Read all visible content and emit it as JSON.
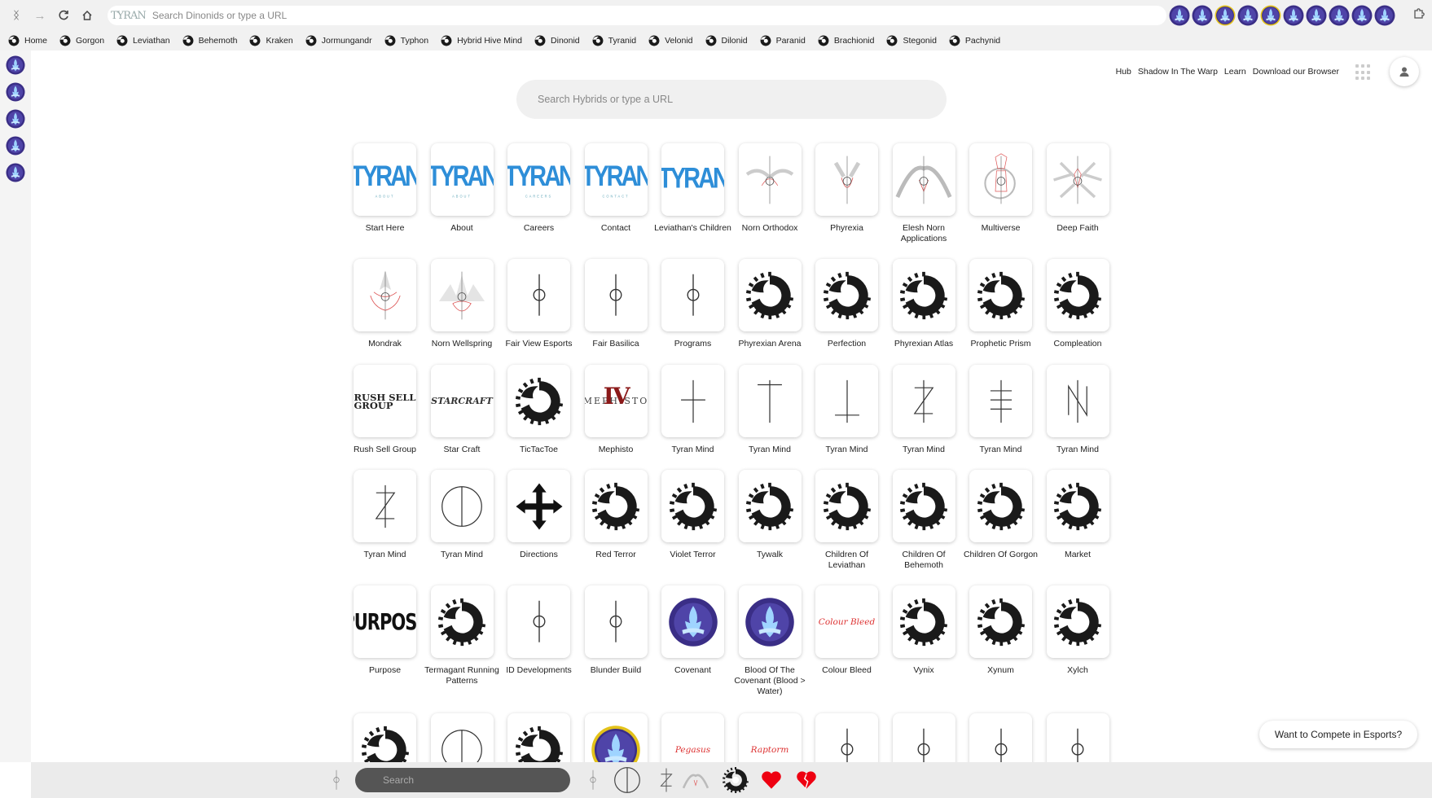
{
  "browser": {
    "url_placeholder": "Search Dinonids or type a URL",
    "logo_text": "TYRAN",
    "extensions_count": 10
  },
  "bookmarks": [
    "Home",
    "Gorgon",
    "Leviathan",
    "Behemoth",
    "Kraken",
    "Jormungandr",
    "Typhon",
    "Hybrid Hive Mind",
    "Dinonid",
    "Tyranid",
    "Velonid",
    "Dilonid",
    "Paranid",
    "Brachionid",
    "Stegonid",
    "Pachynid"
  ],
  "nav": {
    "links": [
      "Hub",
      "Shadow In The Warp",
      "Learn",
      "Download our Browser"
    ]
  },
  "search": {
    "placeholder": "Search Hybrids or type a URL"
  },
  "tiles": [
    {
      "label": "Start Here",
      "icon": "tyran-logo",
      "logo_text": "TYRAN",
      "logo_sub": "ABOUT"
    },
    {
      "label": "About",
      "icon": "tyran-logo",
      "logo_text": "TYRAN",
      "logo_sub": "ABOUT"
    },
    {
      "label": "Careers",
      "icon": "tyran-logo",
      "logo_text": "TYRAN",
      "logo_sub": "CAREERS"
    },
    {
      "label": "Contact",
      "icon": "tyran-logo",
      "logo_text": "TYRAN",
      "logo_sub": "CONTACT"
    },
    {
      "label": "Leviathan's Children",
      "icon": "tyran-logo",
      "logo_text": "TYRAN",
      "logo_sub": ""
    },
    {
      "label": "Norn Orthodox",
      "icon": "norn-orthodox-icon"
    },
    {
      "label": "Phyrexia",
      "icon": "phyrexia-icon"
    },
    {
      "label": "Elesh Norn Applications",
      "icon": "elesh-norn-icon"
    },
    {
      "label": "Multiverse",
      "icon": "multiverse-icon"
    },
    {
      "label": "Deep Faith",
      "icon": "deep-faith-icon"
    },
    {
      "label": "Mondrak",
      "icon": "mondrak-icon"
    },
    {
      "label": "Norn Wellspring",
      "icon": "norn-wellspring-icon"
    },
    {
      "label": "Fair View Esports",
      "icon": "phyrexian-glyph-icon"
    },
    {
      "label": "Fair Basilica",
      "icon": "phyrexian-glyph-icon"
    },
    {
      "label": "Programs",
      "icon": "phyrexian-glyph-icon"
    },
    {
      "label": "Phyrexian Arena",
      "icon": "tyranid-hive-icon"
    },
    {
      "label": "Perfection",
      "icon": "tyranid-hive-icon"
    },
    {
      "label": "Phyrexian Atlas",
      "icon": "tyranid-hive-icon"
    },
    {
      "label": "Prophetic Prism",
      "icon": "tyranid-hive-icon"
    },
    {
      "label": "Compleation",
      "icon": "tyranid-hive-icon"
    },
    {
      "label": "Rush Sell Group",
      "icon": "rush-sell-logo",
      "logo_text": "RUSH SELL GROUP"
    },
    {
      "label": "Star Craft",
      "icon": "starcraft-logo",
      "logo_text": "STARCRAFT"
    },
    {
      "label": "TicTacToe",
      "icon": "tyranid-hive-icon"
    },
    {
      "label": "Mephisto",
      "icon": "mephisto-logo",
      "logo_text": "MEPHISTO",
      "logo_numeral": "IV"
    },
    {
      "label": "Tyran Mind",
      "icon": "rune-cross-icon"
    },
    {
      "label": "Tyran Mind",
      "icon": "rune-t-icon"
    },
    {
      "label": "Tyran Mind",
      "icon": "rune-inverted-t-icon"
    },
    {
      "label": "Tyran Mind",
      "icon": "rune-z-icon"
    },
    {
      "label": "Tyran Mind",
      "icon": "rune-triple-bar-icon"
    },
    {
      "label": "Tyran Mind",
      "icon": "rune-n-icon"
    },
    {
      "label": "Tyran Mind",
      "icon": "rune-z-icon"
    },
    {
      "label": "Tyran Mind",
      "icon": "rune-circle-icon"
    },
    {
      "label": "Directions",
      "icon": "directions-icon"
    },
    {
      "label": "Red Terror",
      "icon": "tyranid-hive-icon"
    },
    {
      "label": "Violet Terror",
      "icon": "tyranid-hive-icon"
    },
    {
      "label": "Tywalk",
      "icon": "tyranid-hive-icon"
    },
    {
      "label": "Children Of Leviathan",
      "icon": "tyranid-hive-icon"
    },
    {
      "label": "Children Of Behemoth",
      "icon": "tyranid-hive-icon"
    },
    {
      "label": "Children Of Gorgon",
      "icon": "tyranid-hive-icon"
    },
    {
      "label": "Market",
      "icon": "tyranid-hive-icon"
    },
    {
      "label": "Purpose",
      "icon": "purpose-logo",
      "logo_text": "PURPOSE"
    },
    {
      "label": "Termagant Running Patterns",
      "icon": "tyranid-hive-icon"
    },
    {
      "label": "ID Developments",
      "icon": "phyrexian-glyph-icon"
    },
    {
      "label": "Blunder Build",
      "icon": "phyrexian-glyph-icon"
    },
    {
      "label": "Covenant",
      "icon": "covenant-emblem-icon"
    },
    {
      "label": "Blood Of The Covenant (Blood > Water)",
      "icon": "covenant-emblem-icon"
    },
    {
      "label": "Colour Bleed",
      "icon": "colour-bleed-logo",
      "logo_text": "Colour Bleed"
    },
    {
      "label": "Vynix",
      "icon": "tyranid-hive-icon"
    },
    {
      "label": "Xynum",
      "icon": "tyranid-hive-icon"
    },
    {
      "label": "Xylch",
      "icon": "tyranid-hive-icon"
    },
    {
      "label": "",
      "icon": "tyranid-hive-icon"
    },
    {
      "label": "",
      "icon": "rune-circle-icon"
    },
    {
      "label": "",
      "icon": "tyranid-hive-icon"
    },
    {
      "label": "",
      "icon": "covenant-gold-emblem-icon"
    },
    {
      "label": "",
      "icon": "pegasus-script-logo",
      "logo_text": "Pegasus"
    },
    {
      "label": "",
      "icon": "raptorm-script-logo",
      "logo_text": "Raptorm"
    },
    {
      "label": "",
      "icon": "phyrexian-glyph-icon"
    },
    {
      "label": "",
      "icon": "phyrexian-glyph-icon"
    },
    {
      "label": "",
      "icon": "phyrexian-glyph-icon"
    },
    {
      "label": "",
      "icon": "phyrexian-glyph-icon"
    }
  ],
  "dock": {
    "search_placeholder": "Search",
    "icons": [
      "phyrexian-glyph-icon",
      "phyrexian-glyph-icon",
      "rune-circle-icon",
      "rune-z-icon",
      "elesh-norn-icon",
      "tyranid-hive-icon",
      "red-heart-icon",
      "broken-heart-icon"
    ]
  },
  "compete_button": "Want to Compete in Esports?",
  "colors": {
    "tyran_blue": "#2e8ed8",
    "hive_black": "#1a1a1a",
    "covenant_purple": "#4a3c9a",
    "phyrexian_red": "#d44"
  }
}
